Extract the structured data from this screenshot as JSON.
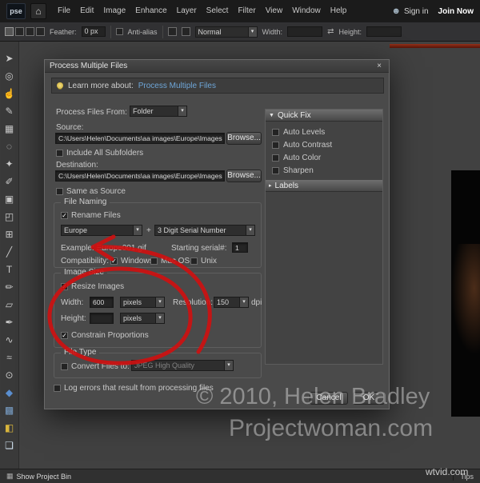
{
  "icons": {
    "close": "×",
    "dropdown_arrow": "▾",
    "check": "✓",
    "collapse_open": "▼",
    "collapse_closed": "▸",
    "swap": "⇄",
    "home": "⌂",
    "person": "☻",
    "project_bin": "▦"
  },
  "menu_bar": {
    "logo": "pse",
    "menus": [
      "File",
      "Edit",
      "Image",
      "Enhance",
      "Layer",
      "Select",
      "Filter",
      "View",
      "Window",
      "Help"
    ],
    "sign_in": "Sign in",
    "join_now": "Join Now"
  },
  "options_bar": {
    "feather_label": "Feather:",
    "feather_value": "0 px",
    "antialias_label": "Anti-alias",
    "blend_mode": "Normal",
    "width_label": "Width:",
    "height_label": "Height:"
  },
  "tools": [
    {
      "name": "move-tool",
      "glyph": "➤"
    },
    {
      "name": "zoom-tool",
      "glyph": "◎"
    },
    {
      "name": "hand-tool",
      "glyph": "☝"
    },
    {
      "name": "eyedropper-tool",
      "glyph": "✎"
    },
    {
      "name": "marquee-tool",
      "glyph": "▦"
    },
    {
      "name": "lasso-tool",
      "glyph": "◌"
    },
    {
      "name": "magic-wand-tool",
      "glyph": "✦"
    },
    {
      "name": "quick-selection-tool",
      "glyph": "✐"
    },
    {
      "name": "crop-tool",
      "glyph": "▣"
    },
    {
      "name": "recompose-tool",
      "glyph": "◰"
    },
    {
      "name": "content-move-tool",
      "glyph": "⊞"
    },
    {
      "name": "straighten-tool",
      "glyph": "╱"
    },
    {
      "name": "type-tool",
      "glyph": "T"
    },
    {
      "name": "pencil-tool",
      "glyph": "✏"
    },
    {
      "name": "eraser-tool",
      "glyph": "▱"
    },
    {
      "name": "brush-tool",
      "glyph": "✒"
    },
    {
      "name": "impressionist-brush-tool",
      "glyph": "∿"
    },
    {
      "name": "smudge-tool",
      "glyph": "≈"
    },
    {
      "name": "sponge-tool",
      "glyph": "⊙"
    },
    {
      "name": "shape-tool",
      "glyph": "◆",
      "color": "#5b8fd0"
    },
    {
      "name": "gradient-tool",
      "glyph": "▩",
      "color": "#7aa0c8"
    },
    {
      "name": "paint-bucket-tool",
      "glyph": "◧",
      "color": "#d8b53c"
    },
    {
      "name": "color-swatches",
      "glyph": "❏",
      "color": "#cfe0ee"
    }
  ],
  "dialog": {
    "title": "Process Multiple Files",
    "learn_more_label": "Learn more about:",
    "learn_more_link": "Process Multiple Files",
    "process_from_label": "Process Files From:",
    "process_from_value": "Folder",
    "source_label": "Source:",
    "source_value": "C:\\Users\\Helen\\Documents\\aa images\\Europe\\Images fo",
    "browse_label": "Browse...",
    "include_subfolders": "Include All Subfolders",
    "destination_label": "Destination:",
    "destination_value": "C:\\Users\\Helen\\Documents\\aa images\\Europe\\Images fo",
    "same_as_source": "Same as Source",
    "file_naming": {
      "title": "File Naming",
      "rename_files": "Rename Files",
      "name_value": "Europe",
      "plus": "+",
      "serial_value": "3 Digit Serial Number",
      "example": "Example: Europe001.gif",
      "starting_serial_label": "Starting serial#:",
      "starting_serial_value": "1",
      "compatibility_label": "Compatibility:",
      "windows": "Windows",
      "macos": "Mac OS",
      "unix": "Unix"
    },
    "image_size": {
      "title": "Image Size",
      "resize_images": "Resize Images",
      "width_label": "Width:",
      "width_value": "600",
      "pixels": "pixels",
      "resolution_label": "Resolution:",
      "resolution_value": "150",
      "dpi": "dpi",
      "height_label": "Height:",
      "height_value": "",
      "constrain": "Constrain Proportions"
    },
    "file_type": {
      "title": "File Type",
      "convert_label": "Convert Files to:",
      "convert_value": "JPEG High Quality"
    },
    "log_errors": "Log errors that result from processing files",
    "cancel": "Cancel",
    "ok": "OK",
    "quick_fix": {
      "title": "Quick Fix",
      "items": [
        "Auto Levels",
        "Auto Contrast",
        "Auto Color",
        "Sharpen"
      ]
    },
    "labels_title": "Labels"
  },
  "watermark": {
    "line1": "© 2010, Helen Bradley",
    "line2": "Projectwoman.com",
    "small": "wtvid.com"
  },
  "status_bar": {
    "show_project_bin": "Show Project Bin",
    "tips": "Tips"
  },
  "annotation_color": "#d01010"
}
